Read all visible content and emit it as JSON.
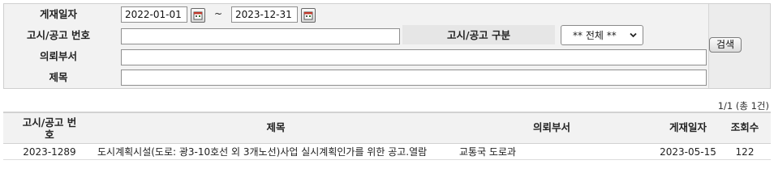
{
  "search": {
    "date_label": "게재일자",
    "date_from": "2022-01-01",
    "date_separator": "~",
    "date_to": "2023-12-31",
    "notice_no_label": "고시/공고 번호",
    "notice_no_value": "",
    "notice_type_label": "고시/공고 구분",
    "notice_type_selected": "** 전체 **",
    "dept_label": "의뢰부서",
    "dept_value": "",
    "title_label": "제목",
    "title_value": "",
    "search_button": "검색"
  },
  "results": {
    "count_text": "1/1 (총 1건)",
    "columns": {
      "notice_no": "고시/공고 번호",
      "title": "제목",
      "dept": "의뢰부서",
      "date": "게재일자",
      "views": "조회수"
    },
    "rows": [
      {
        "notice_no": "2023-1289",
        "title": "도시계획시설(도로: 광3-10호선 외 3개노선)사업 실시계획인가를 위한 공고.열람",
        "dept": "교통국 도로과",
        "date": "2023-05-15",
        "views": "122"
      }
    ]
  }
}
